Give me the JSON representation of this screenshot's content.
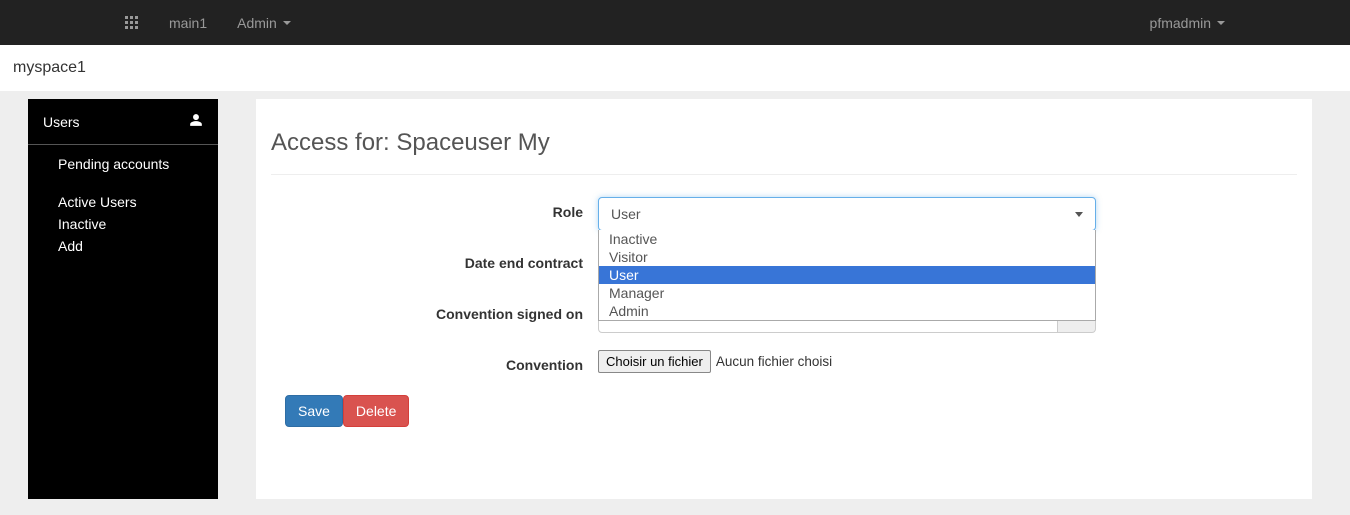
{
  "navbar": {
    "main_link": "main1",
    "admin_label": "Admin",
    "user_menu": "pfmadmin"
  },
  "breadcrumb": {
    "space": "myspace1"
  },
  "sidebar": {
    "header": "Users",
    "items": [
      "Pending accounts",
      "Active Users",
      "Inactive",
      "Add"
    ]
  },
  "page": {
    "title_prefix": "Access for: ",
    "title_name": "Spaceuser My"
  },
  "form": {
    "role_label": "Role",
    "role_value": "User",
    "role_options": [
      "Inactive",
      "Visitor",
      "User",
      "Manager",
      "Admin"
    ],
    "date_label": "Date end contract",
    "convention_signed_label": "Convention signed on",
    "convention_label": "Convention",
    "file_button": "Choisir un fichier",
    "file_status": "Aucun fichier choisi"
  },
  "actions": {
    "save": "Save",
    "delete": "Delete"
  }
}
